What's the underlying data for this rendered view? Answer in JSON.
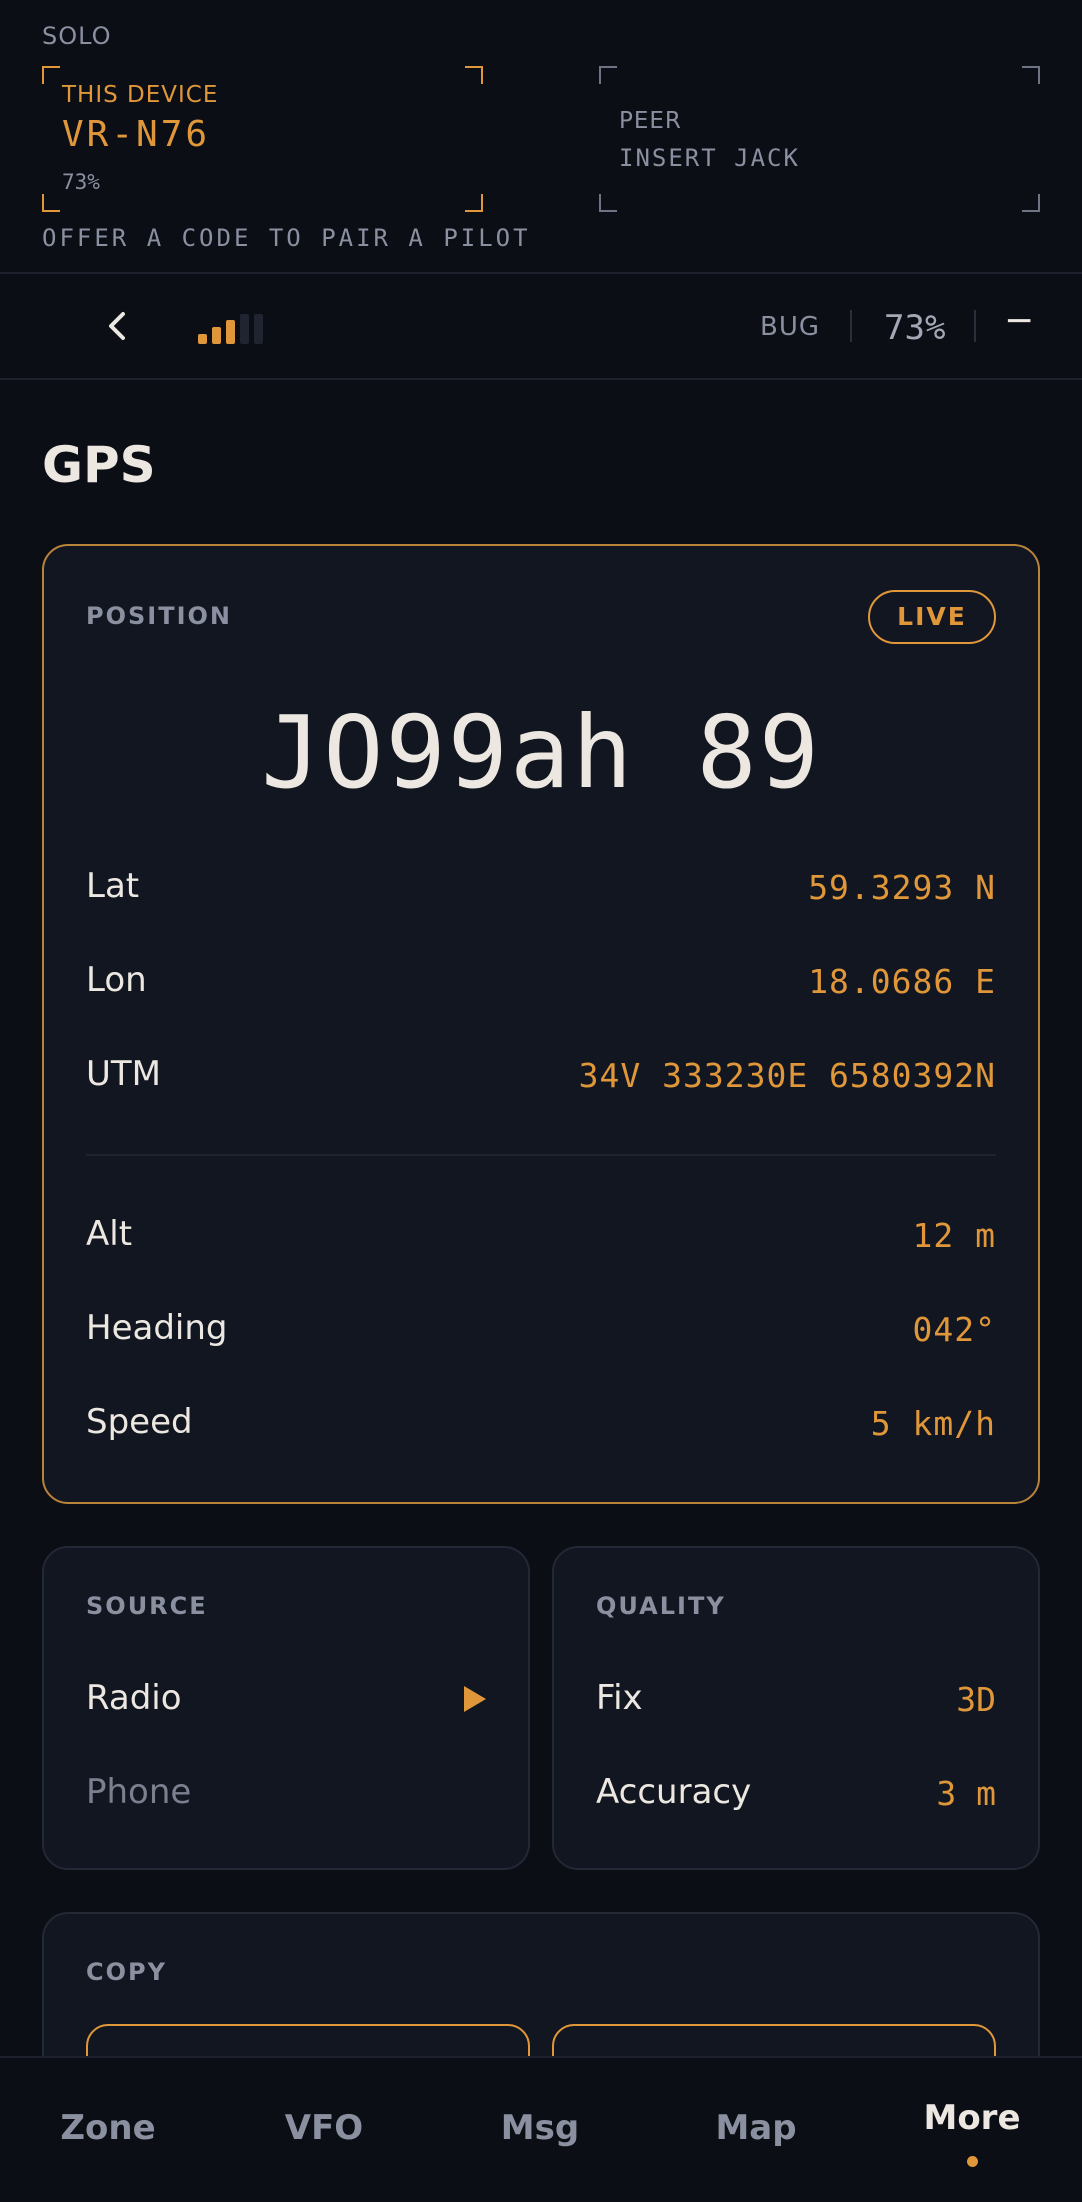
{
  "pairing": {
    "mode": "SOLO",
    "device": {
      "title": "THIS DEVICE",
      "name": "VR-N76",
      "battery": "73%"
    },
    "peer": {
      "title": "PEER",
      "subtitle": "INSERT JACK"
    },
    "hint": "OFFER A CODE TO PAIR A PILOT"
  },
  "status": {
    "back_icon": "chevron-left-icon",
    "signal_bars_on": 3,
    "signal_bars_total": 5,
    "bug_label": "BUG",
    "battery": "73%",
    "minus_label": "−"
  },
  "page": {
    "title": "GPS"
  },
  "position": {
    "label": "POSITION",
    "live_badge": "LIVE",
    "locator": "JO99ah 89",
    "rows": [
      {
        "key": "Lat",
        "value": "59.3293 N"
      },
      {
        "key": "Lon",
        "value": "18.0686 E"
      },
      {
        "key": "UTM",
        "value": "34V 333230E 6580392N"
      },
      {
        "key": "Alt",
        "value": "12 m"
      },
      {
        "key": "Heading",
        "value": "042°"
      },
      {
        "key": "Speed",
        "value": "5 km/h"
      }
    ]
  },
  "source": {
    "label": "SOURCE",
    "options": [
      {
        "name": "Radio",
        "selected": true
      },
      {
        "name": "Phone",
        "selected": false
      }
    ]
  },
  "quality": {
    "label": "QUALITY",
    "rows": [
      {
        "key": "Fix",
        "value": "3D"
      },
      {
        "key": "Accuracy",
        "value": "3 m"
      }
    ]
  },
  "copy": {
    "label": "COPY"
  },
  "nav": {
    "items": [
      "Zone",
      "VFO",
      "Msg",
      "Map",
      "More"
    ],
    "active": "More"
  },
  "colors": {
    "accent": "#e0973a",
    "background": "#0b0e15",
    "card": "#121620"
  }
}
